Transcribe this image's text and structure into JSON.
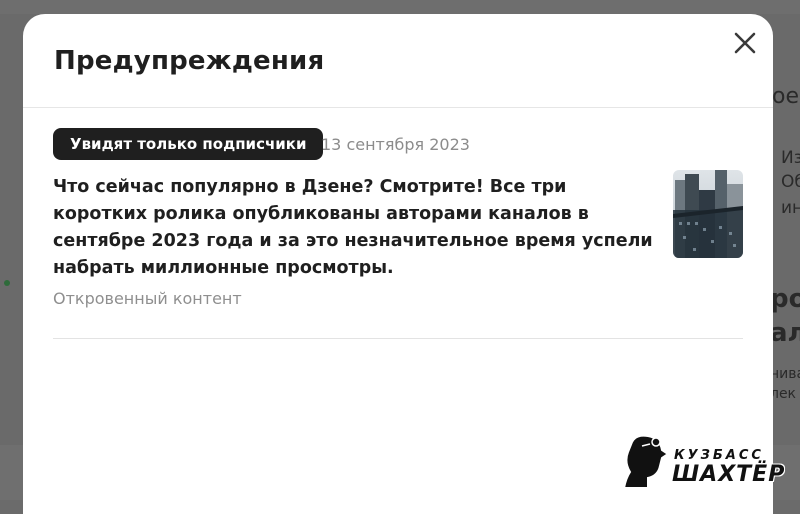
{
  "background_page": {
    "snippets": [
      "ое",
      "Из",
      "Об",
      "ин",
      "род",
      "ал",
      "нива",
      "лек"
    ]
  },
  "modal": {
    "title": "Предупреждения",
    "close_icon": "close-icon",
    "items": [
      {
        "badge": "Увидят только подписчики",
        "date": "13 сентября 2023",
        "text": "Что сейчас популярно в Дзене? Смотрите! Все три коротких ролика опубликованы авторами каналов в сентябре 2023 года и за это незначительное время успели набрать миллионные просмотры.",
        "source": "Откровенный контент",
        "thumbnail_icon": "city-skyscraper-thumbnail"
      }
    ]
  },
  "watermark": {
    "line1": "КУЗБАСС",
    "line2": "ШАХТЁР",
    "icon": "miner-head-logo"
  },
  "colors": {
    "overlay": "#6b6b6b",
    "modal_bg": "#ffffff",
    "badge_bg": "#1f1f1f",
    "text_primary": "#1f1f1f",
    "text_secondary": "#8c8c8c"
  }
}
